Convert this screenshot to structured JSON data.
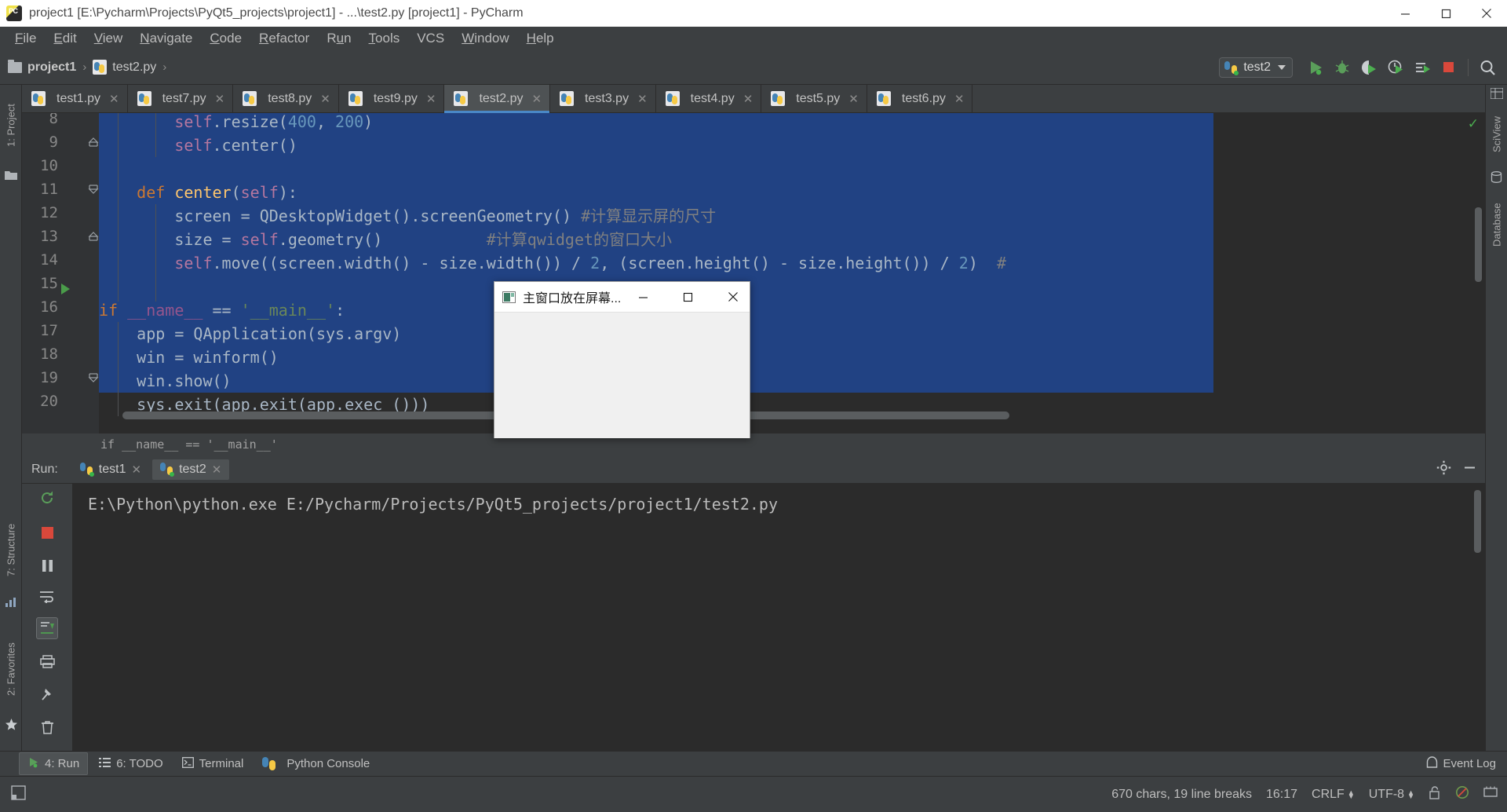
{
  "window": {
    "title": "project1 [E:\\Pycharm\\Projects\\PyQt5_projects\\project1] - ...\\test2.py [project1] - PyCharm",
    "app_icon": "pycharm-logo",
    "minimize_label": "Minimize",
    "maximize_label": "Maximize",
    "close_label": "Close"
  },
  "menu": {
    "items": [
      {
        "label": "File"
      },
      {
        "label": "Edit"
      },
      {
        "label": "View"
      },
      {
        "label": "Navigate"
      },
      {
        "label": "Code"
      },
      {
        "label": "Refactor"
      },
      {
        "label": "Run"
      },
      {
        "label": "Tools"
      },
      {
        "label": "VCS"
      },
      {
        "label": "Window"
      },
      {
        "label": "Help"
      }
    ]
  },
  "breadcrumb": {
    "project": "project1",
    "file": "test2.py",
    "separator": "›"
  },
  "toolbar": {
    "run_config": "test2",
    "icons": [
      {
        "name": "run-icon",
        "tooltip": "Run"
      },
      {
        "name": "debug-icon",
        "tooltip": "Debug"
      },
      {
        "name": "run-with-coverage-icon",
        "tooltip": "Run with Coverage"
      },
      {
        "name": "profile-icon",
        "tooltip": "Profile"
      },
      {
        "name": "run-anything-icon",
        "tooltip": "Run Anything"
      },
      {
        "name": "stop-icon",
        "tooltip": "Stop"
      },
      {
        "name": "search-everywhere-icon",
        "tooltip": "Search Everywhere"
      }
    ]
  },
  "left_strip": {
    "project_tab": "1: Project",
    "structure_tab": "7: Structure",
    "favorites_tab": "2: Favorites"
  },
  "right_strip": {
    "sciview_tab": "SciView",
    "database_tab": "Database"
  },
  "editor_tabs": [
    {
      "label": "test1.py",
      "active": false
    },
    {
      "label": "test7.py",
      "active": false
    },
    {
      "label": "test8.py",
      "active": false
    },
    {
      "label": "test9.py",
      "active": false
    },
    {
      "label": "test2.py",
      "active": true
    },
    {
      "label": "test3.py",
      "active": false
    },
    {
      "label": "test4.py",
      "active": false
    },
    {
      "label": "test5.py",
      "active": false
    },
    {
      "label": "test6.py",
      "active": false
    }
  ],
  "editor": {
    "first_line_number": 8,
    "lines": [
      {
        "n": "8",
        "text": "        self.resize(400, 200)"
      },
      {
        "n": "9",
        "text": "        self.center()"
      },
      {
        "n": "10",
        "text": ""
      },
      {
        "n": "11",
        "text": "    def center(self):"
      },
      {
        "n": "12",
        "text": "        screen = QDesktopWidget().screenGeometry() #计算显示屏的尺寸"
      },
      {
        "n": "13",
        "text": "        size = self.geometry()           #计算qwidget的窗口大小"
      },
      {
        "n": "14",
        "text": "        self.move((screen.width() - size.width()) / 2, (screen.height() - size.height()) / 2)  #"
      },
      {
        "n": "15",
        "text": ""
      },
      {
        "n": "16",
        "text": "if __name__ == '__main__':"
      },
      {
        "n": "17",
        "text": "    app = QApplication(sys.argv)"
      },
      {
        "n": "18",
        "text": "    win = winform()"
      },
      {
        "n": "19",
        "text": "    win.show()"
      },
      {
        "n": "20",
        "text": "    sys.exit(app.exit(app.exec_()))"
      }
    ],
    "breadcrumb_text": "if __name__ == '__main__'",
    "selection_color": "#214283"
  },
  "run_panel": {
    "label": "Run:",
    "tabs": [
      {
        "label": "test1",
        "active": false
      },
      {
        "label": "test2",
        "active": true
      }
    ],
    "console_output": "E:\\Python\\python.exe E:/Pycharm/Projects/PyQt5_projects/project1/test2.py",
    "side_buttons": [
      {
        "name": "rerun-icon"
      },
      {
        "name": "stop-icon"
      },
      {
        "name": "pause-icon"
      },
      {
        "name": "trace-icon"
      },
      {
        "name": "print-icon"
      },
      {
        "name": "soft-wrap-icon"
      },
      {
        "name": "scroll-to-end-icon"
      },
      {
        "name": "pin-icon"
      },
      {
        "name": "delete-icon"
      }
    ],
    "header_buttons": [
      {
        "name": "settings-gear-icon"
      },
      {
        "name": "hide-icon"
      }
    ]
  },
  "bottom_bar": {
    "items": [
      {
        "label": "4: Run",
        "icon": "run-icon",
        "active": true
      },
      {
        "label": "6: TODO",
        "icon": "todo-icon",
        "active": false
      },
      {
        "label": "Terminal",
        "icon": "terminal-icon",
        "active": false
      },
      {
        "label": "Python Console",
        "icon": "python-icon",
        "active": false
      }
    ],
    "event_log": "Event Log"
  },
  "status_bar": {
    "chars": "670 chars, 19 line breaks",
    "time": "16:17",
    "line_sep": "CRLF",
    "encoding": "UTF-8",
    "icons": [
      {
        "name": "lock-icon"
      },
      {
        "name": "inspection-icon"
      },
      {
        "name": "memory-icon"
      }
    ]
  },
  "qt_dialog": {
    "title": "主窗口放在屏幕...",
    "minimize_label": "—",
    "maximize_label": "□",
    "close_label": "✕"
  }
}
